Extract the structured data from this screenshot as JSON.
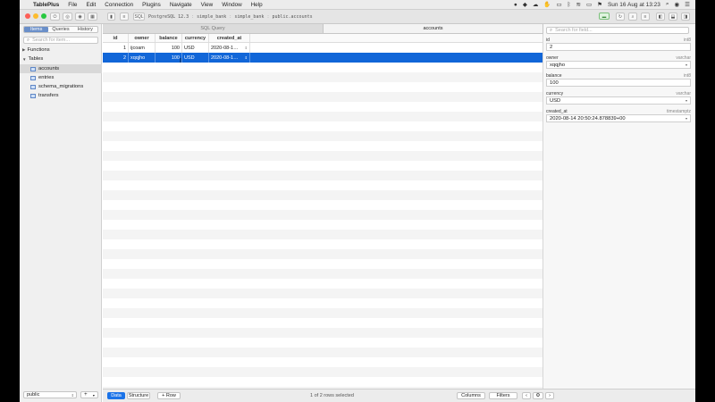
{
  "menubar": {
    "app_name": "TablePlus",
    "items": [
      "File",
      "Edit",
      "Connection",
      "Plugins",
      "Navigate",
      "View",
      "Window",
      "Help"
    ],
    "clock": "Sun 16 Aug at 13:23"
  },
  "toolbar": {
    "sql_label": "SQL",
    "connection": [
      "PostgreSQL 12.3",
      "simple_bank",
      "simple_bank",
      "public.accounts"
    ]
  },
  "sidebar": {
    "segments": [
      "Items",
      "Queries",
      "History"
    ],
    "search_placeholder": "Search for item...",
    "groups": [
      "Functions",
      "Tables"
    ],
    "tables": [
      "accounts",
      "entries",
      "schema_migrations",
      "transfers"
    ],
    "schema": "public"
  },
  "tabs": [
    "SQL Query",
    "accounts"
  ],
  "grid": {
    "columns": [
      "id",
      "owner",
      "balance",
      "currency",
      "created_at"
    ],
    "rows": [
      [
        "1",
        "ijcoam",
        "100",
        "USD",
        "2020-08-1…"
      ],
      [
        "2",
        "xqqjho",
        "100",
        "USD",
        "2020-08-1…"
      ]
    ],
    "selected_row": 1
  },
  "footer": {
    "data_label": "Data",
    "structure_label": "Structure",
    "row_label": "+ Row",
    "status": "1 of 2 rows selected",
    "columns_label": "Columns",
    "filters_label": "Filters"
  },
  "inspector": {
    "search_placeholder": "Search for field...",
    "fields": [
      {
        "name": "id",
        "type": "int8",
        "value": "2"
      },
      {
        "name": "owner",
        "type": "varchar",
        "value": "xqqjho"
      },
      {
        "name": "balance",
        "type": "int8",
        "value": "100"
      },
      {
        "name": "currency",
        "type": "varchar",
        "value": "USD"
      },
      {
        "name": "created_at",
        "type": "timestamptz",
        "value": "2020-08-14 20:50:24.878839+00"
      }
    ]
  },
  "colors": {
    "selection": "#1166d8",
    "accent": "#1b73e8",
    "close": "#fc5f57",
    "minimize": "#fdbc2e",
    "zoom": "#28c840"
  }
}
